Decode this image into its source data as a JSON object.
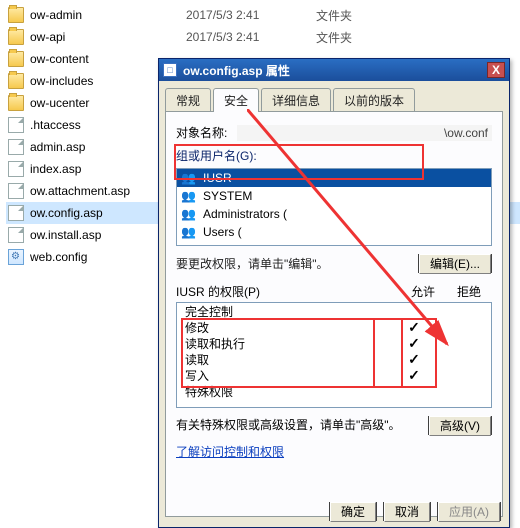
{
  "explorer": {
    "items": [
      {
        "name": "ow-admin",
        "date": "2017/5/3 2:41",
        "type": "文件夹",
        "icon": "folder"
      },
      {
        "name": "ow-api",
        "date": "2017/5/3 2:41",
        "type": "文件夹",
        "icon": "folder"
      },
      {
        "name": "ow-content",
        "date": "",
        "type": "",
        "icon": "folder"
      },
      {
        "name": "ow-includes",
        "date": "",
        "type": "",
        "icon": "folder"
      },
      {
        "name": "ow-ucenter",
        "date": "",
        "type": "",
        "icon": "folder"
      },
      {
        "name": ".htaccess",
        "date": "",
        "type": "",
        "icon": "file"
      },
      {
        "name": "admin.asp",
        "date": "",
        "type": "",
        "icon": "file"
      },
      {
        "name": "index.asp",
        "date": "",
        "type": "",
        "icon": "file"
      },
      {
        "name": "ow.attachment.asp",
        "date": "",
        "type": "",
        "icon": "file"
      },
      {
        "name": "ow.config.asp",
        "date": "",
        "type": "",
        "icon": "file",
        "selected": true
      },
      {
        "name": "ow.install.asp",
        "date": "",
        "type": "",
        "icon": "file"
      },
      {
        "name": "web.config",
        "date": "",
        "type": "",
        "icon": "config"
      }
    ]
  },
  "dialog": {
    "title": "ow.config.asp 属性",
    "tabs": {
      "general": "常规",
      "security": "安全",
      "details": "详细信息",
      "previous": "以前的版本"
    },
    "object_label": "对象名称:",
    "object_value": "\\ow.conf",
    "groups_label": "组或用户名(G):",
    "users": [
      {
        "name": "IUSR",
        "extra": "",
        "selected": true
      },
      {
        "name": "SYSTEM",
        "extra": ""
      },
      {
        "name": "Administrators",
        "extra": "("
      },
      {
        "name": "Users",
        "extra": "("
      }
    ],
    "perm_hint": "要更改权限，请单击\"编辑\"。",
    "edit_btn": "编辑(E)...",
    "perm_title": "IUSR 的权限(P)",
    "allow_label": "允许",
    "deny_label": "拒绝",
    "permissions": [
      {
        "name": "完全控制",
        "allow": "",
        "deny": ""
      },
      {
        "name": "修改",
        "allow": "✓",
        "deny": ""
      },
      {
        "name": "读取和执行",
        "allow": "✓",
        "deny": ""
      },
      {
        "name": "读取",
        "allow": "✓",
        "deny": ""
      },
      {
        "name": "写入",
        "allow": "✓",
        "deny": ""
      },
      {
        "name": "特殊权限",
        "allow": "",
        "deny": ""
      }
    ],
    "adv_text": "有关特殊权限或高级设置，请单击\"高级\"。",
    "adv_btn": "高级(V)",
    "link": "了解访问控制和权限",
    "ok": "确定",
    "cancel": "取消",
    "apply": "应用(A)"
  }
}
